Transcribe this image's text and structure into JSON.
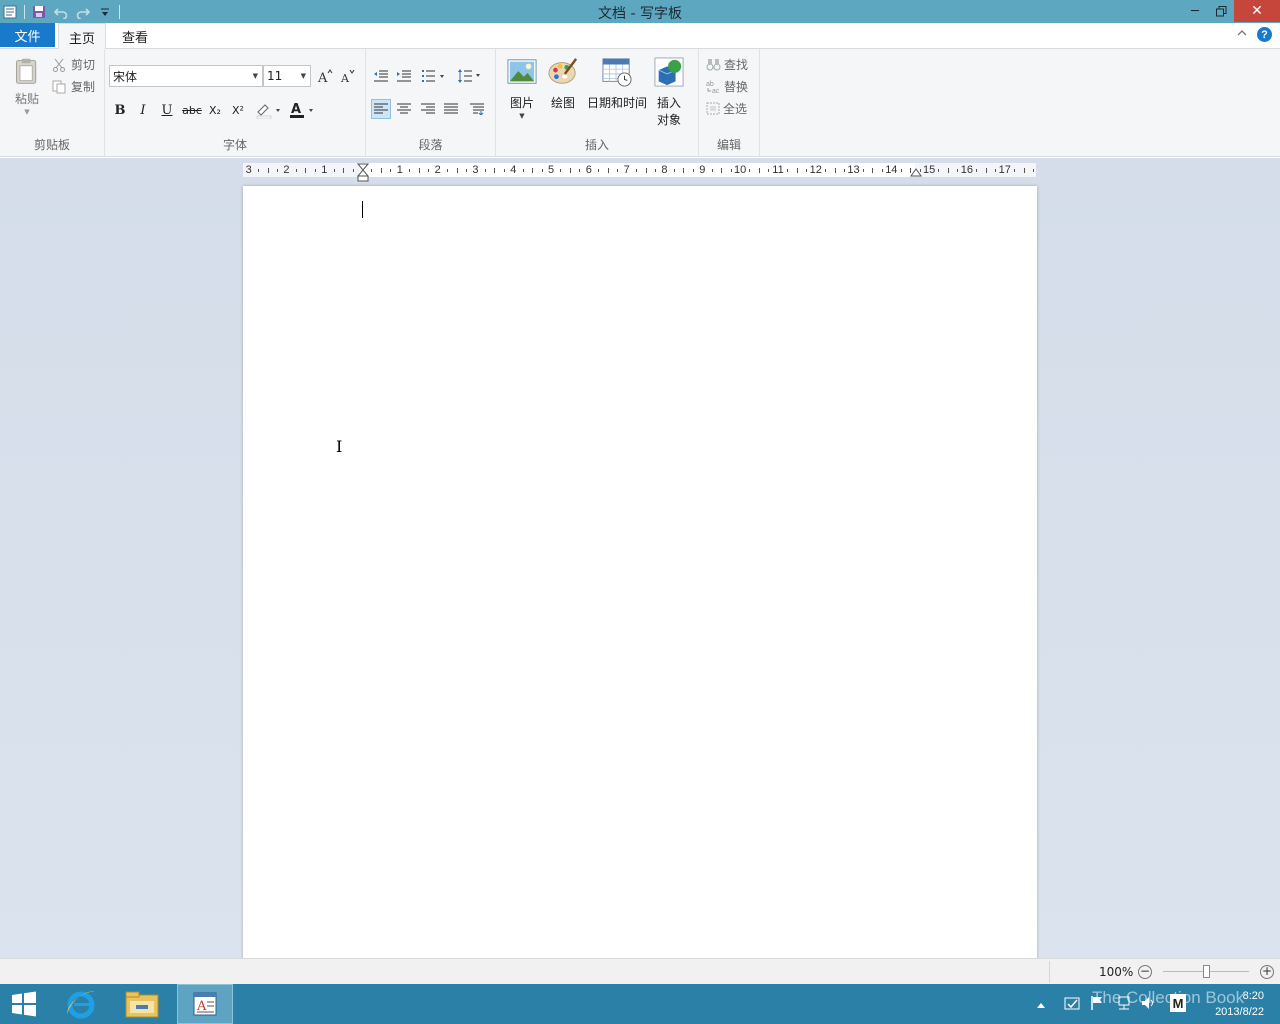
{
  "window": {
    "title": "文档 - 写字板",
    "controls": {
      "minimize": "─",
      "restore": "🗗",
      "close": "✕"
    }
  },
  "tabs": {
    "file": "文件",
    "home": "主页",
    "view": "查看"
  },
  "clipboard": {
    "paste": "粘贴",
    "cut": "剪切",
    "copy": "复制",
    "label": "剪贴板"
  },
  "font": {
    "family": "宋体",
    "size": "11",
    "label": "字体",
    "bold": "B",
    "italic": "I",
    "underline": "U",
    "strike": "abc",
    "subscript": "X₂",
    "superscript": "X²"
  },
  "paragraph": {
    "label": "段落"
  },
  "insert": {
    "picture": "图片",
    "paint": "绘图",
    "datetime": "日期和时间",
    "object_l1": "插入",
    "object_l2": "对象",
    "label": "插入"
  },
  "editing": {
    "find": "查找",
    "replace": "替换",
    "select_all": "全选",
    "label": "编辑"
  },
  "ruler": {
    "labels": [
      "3",
      "2",
      "1",
      "1",
      "2",
      "3",
      "4",
      "5",
      "6",
      "7",
      "8",
      "9",
      "10",
      "11",
      "12",
      "13",
      "14",
      "15",
      "16",
      "17"
    ]
  },
  "status": {
    "zoom": "100%",
    "zoom_out": "−",
    "zoom_in": "+",
    "zoom_value": 0.5
  },
  "taskbar": {
    "time": "8:20",
    "date": "2013/8/22",
    "ime": "M",
    "watermark": "The Collection Book"
  },
  "colors": {
    "titlebar": "#5ea7c1",
    "accent": "#1979ca",
    "taskbar": "#2a80a6",
    "close": "#c7463b"
  }
}
